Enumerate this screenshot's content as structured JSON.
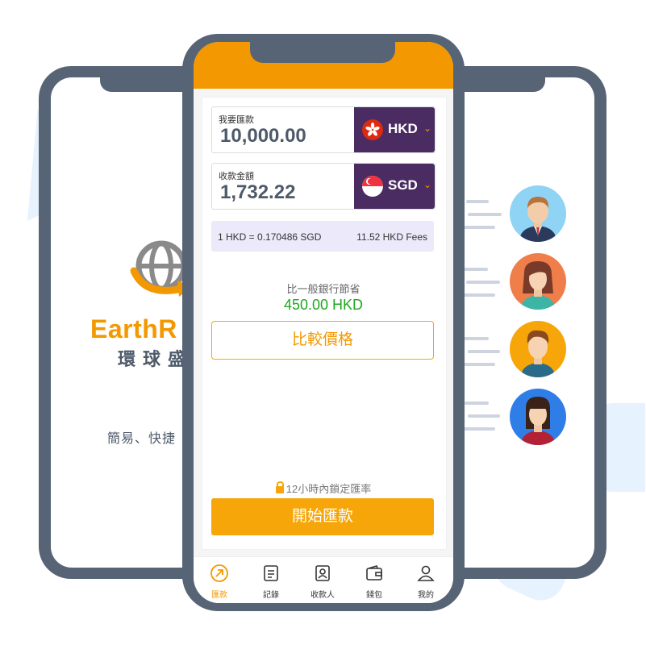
{
  "brand": {
    "name_en": "EarthR",
    "name_zh": "環球盛",
    "tagline": "簡易、快捷"
  },
  "transfer": {
    "send": {
      "label": "我要匯款",
      "amount": "10,000.00",
      "currency": "HKD"
    },
    "receive": {
      "label": "收款金額",
      "amount": "1,732.22",
      "currency": "SGD"
    },
    "rate_text": "1 HKD = 0.170486 SGD",
    "fees_text": "11.52 HKD Fees",
    "savings_label": "比一般銀行節省",
    "savings_value": "450.00 HKD",
    "compare_label": "比較價格",
    "lock_label": "12小時內鎖定匯率",
    "start_label": "開始匯款"
  },
  "nav": {
    "items": [
      {
        "label": "匯款",
        "icon": "send-arrow-icon",
        "active": true
      },
      {
        "label": "記錄",
        "icon": "document-list-icon",
        "active": false
      },
      {
        "label": "收款人",
        "icon": "contact-book-icon",
        "active": false
      },
      {
        "label": "錢包",
        "icon": "wallet-icon",
        "active": false
      },
      {
        "label": "我的",
        "icon": "user-icon",
        "active": false
      }
    ]
  },
  "colors": {
    "accent": "#f39800",
    "device": "#576475",
    "currency_bg": "#4a2c63",
    "savings": "#1fa81f"
  }
}
